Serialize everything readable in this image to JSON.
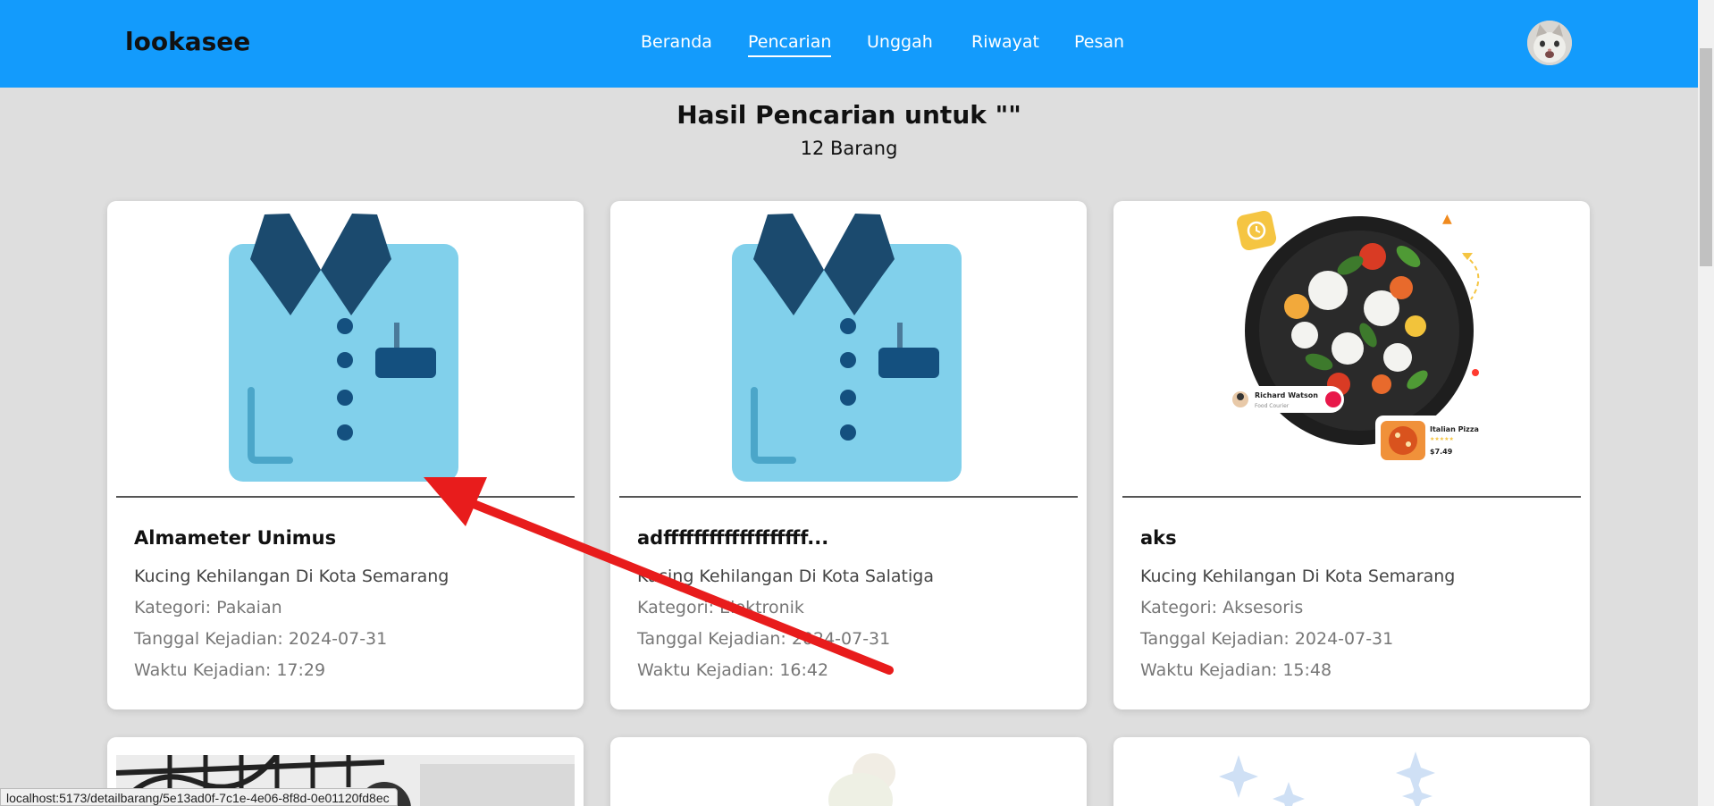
{
  "header": {
    "brand": "lookasee",
    "nav": [
      {
        "label": "Beranda"
      },
      {
        "label": "Pencarian",
        "active": true
      },
      {
        "label": "Unggah"
      },
      {
        "label": "Riwayat"
      },
      {
        "label": "Pesan"
      }
    ],
    "accent_color": "#139bfc"
  },
  "results": {
    "title": "Hasil Pencarian untuk \"\"",
    "count": "12 Barang"
  },
  "cards": [
    {
      "title": "Almameter Unimus",
      "desc": "Kucing Kehilangan Di Kota Semarang",
      "category": "Kategori: Pakaian",
      "date": "Tanggal Kejadian: 2024-07-31",
      "time": "Waktu Kejadian: 17:29",
      "image": "shirt-illustration"
    },
    {
      "title": "adfffffffffffffffffff...",
      "desc": "Kucing Kehilangan Di Kota Salatiga",
      "category": "Kategori: Elektronik",
      "date": "Tanggal Kejadian: 2024-07-31",
      "time": "Waktu Kejadian: 16:42",
      "image": "shirt-illustration"
    },
    {
      "title": "aks",
      "desc": "Kucing Kehilangan Di Kota Semarang",
      "category": "Kategori: Aksesoris",
      "date": "Tanggal Kejadian: 2024-07-31",
      "time": "Waktu Kejadian: 15:48",
      "image": "food-delivery-salad",
      "image_texts": {
        "courier_name": "Richard Watson",
        "courier_role": "Food Courier",
        "dish_name": "Italian Pizza",
        "dish_price": "$7.49"
      }
    }
  ],
  "status_bar": {
    "url": "localhost:5173/detailbarang/5e13ad0f-7c1e-4e06-8f8d-0e01120fd8ec"
  },
  "annotation_color": "#e81c1c"
}
